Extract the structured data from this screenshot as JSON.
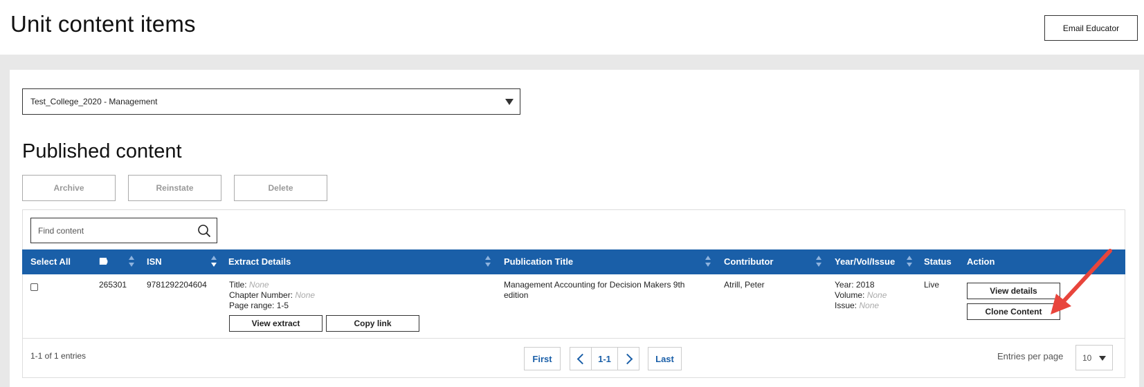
{
  "header": {
    "title": "Unit content items",
    "email_button": "Email Educator"
  },
  "unit_select": {
    "value": "Test_College_2020 - Management"
  },
  "section": {
    "title": "Published content"
  },
  "bulk_actions": {
    "archive": "Archive",
    "reinstate": "Reinstate",
    "delete": "Delete"
  },
  "search": {
    "placeholder": "Find content"
  },
  "table": {
    "columns": {
      "select_all": "Select All",
      "id": "ID",
      "isn": "ISN",
      "extract_details": "Extract Details",
      "publication_title": "Publication Title",
      "contributor": "Contributor",
      "year_vol_issue": "Year/Vol/Issue",
      "status": "Status",
      "action": "Action"
    },
    "rows": [
      {
        "id": "265301",
        "isn": "9781292204604",
        "title_label": "Title:",
        "title_value": "None",
        "chapter_label": "Chapter Number:",
        "chapter_value": "None",
        "page_range": "Page range: 1-5",
        "view_extract": "View extract",
        "copy_link": "Copy link",
        "publication_title_line1": "Management Accounting for Decision Makers 9th",
        "publication_title_line2": "edition",
        "contributor": "Atrill, Peter",
        "year": "Year: 2018",
        "volume_label": "Volume:",
        "volume_value": "None",
        "issue_label": "Issue:",
        "issue_value": "None",
        "status": "Live",
        "view_details": "View details",
        "clone_content": "Clone Content"
      }
    ]
  },
  "pagination": {
    "summary": "1-1 of 1 entries",
    "first": "First",
    "current": "1-1",
    "last": "Last",
    "per_page_label": "Entries per page",
    "per_page_value": "10"
  },
  "colors": {
    "header_bg": "#1a5fa8",
    "accent_link": "#1a5fa8",
    "annotation_arrow": "#e8453c"
  }
}
